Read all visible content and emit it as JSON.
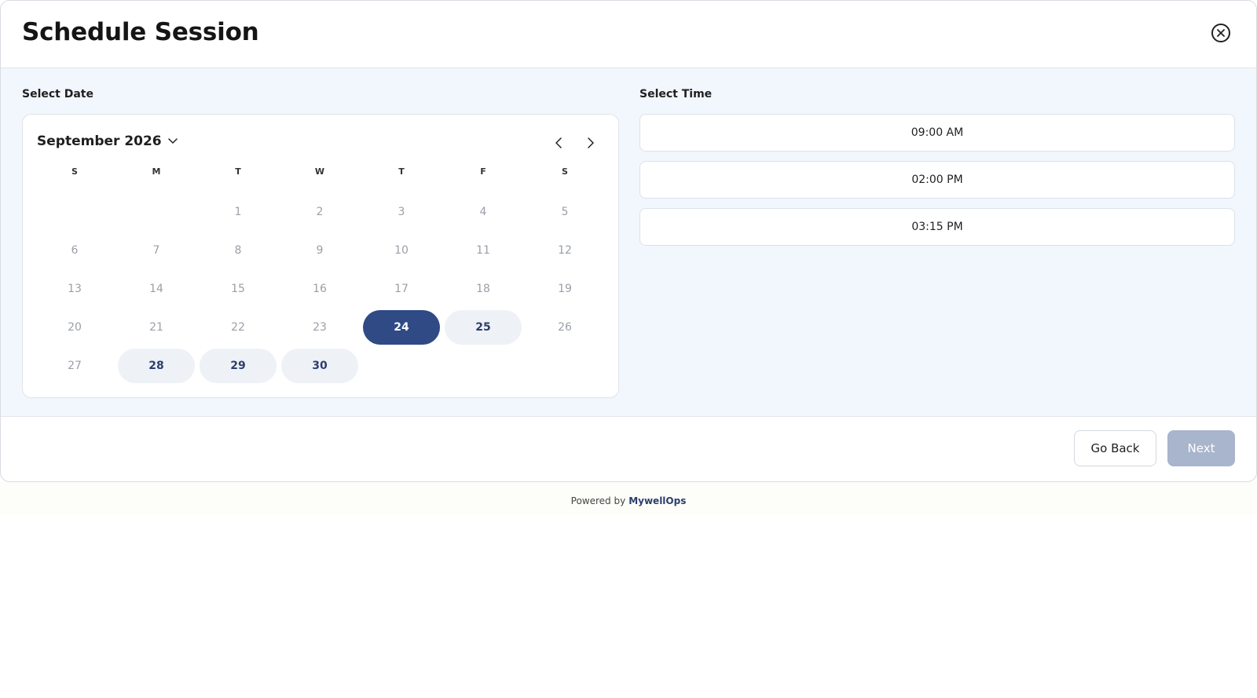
{
  "modal": {
    "title": "Schedule Session"
  },
  "date_section": {
    "label": "Select Date",
    "month_label": "September 2026",
    "weekdays": [
      "S",
      "M",
      "T",
      "W",
      "T",
      "F",
      "S"
    ],
    "days": [
      {
        "label": "",
        "state": "empty"
      },
      {
        "label": "",
        "state": "empty"
      },
      {
        "label": "1",
        "state": "disabled"
      },
      {
        "label": "2",
        "state": "disabled"
      },
      {
        "label": "3",
        "state": "disabled"
      },
      {
        "label": "4",
        "state": "disabled"
      },
      {
        "label": "5",
        "state": "disabled"
      },
      {
        "label": "6",
        "state": "disabled"
      },
      {
        "label": "7",
        "state": "disabled"
      },
      {
        "label": "8",
        "state": "disabled"
      },
      {
        "label": "9",
        "state": "disabled"
      },
      {
        "label": "10",
        "state": "disabled"
      },
      {
        "label": "11",
        "state": "disabled"
      },
      {
        "label": "12",
        "state": "disabled"
      },
      {
        "label": "13",
        "state": "disabled"
      },
      {
        "label": "14",
        "state": "disabled"
      },
      {
        "label": "15",
        "state": "disabled"
      },
      {
        "label": "16",
        "state": "disabled"
      },
      {
        "label": "17",
        "state": "disabled"
      },
      {
        "label": "18",
        "state": "disabled"
      },
      {
        "label": "19",
        "state": "disabled"
      },
      {
        "label": "20",
        "state": "disabled"
      },
      {
        "label": "21",
        "state": "disabled"
      },
      {
        "label": "22",
        "state": "disabled"
      },
      {
        "label": "23",
        "state": "disabled"
      },
      {
        "label": "24",
        "state": "selected"
      },
      {
        "label": "25",
        "state": "available"
      },
      {
        "label": "26",
        "state": "disabled"
      },
      {
        "label": "27",
        "state": "disabled"
      },
      {
        "label": "28",
        "state": "available"
      },
      {
        "label": "29",
        "state": "available"
      },
      {
        "label": "30",
        "state": "available"
      }
    ]
  },
  "time_section": {
    "label": "Select Time",
    "slots": [
      "09:00 AM",
      "02:00 PM",
      "03:15 PM"
    ]
  },
  "actions": {
    "back_label": "Go Back",
    "next_label": "Next"
  },
  "footer": {
    "powered_by": "Powered by",
    "brand": "MywellOps"
  },
  "colors": {
    "selected": "#2f4a85",
    "available_bg": "#eef1f6",
    "body_bg": "#f2f6fd",
    "next_disabled": "#a9b5cc"
  },
  "icons": {
    "close": "close-circle-icon",
    "month_dropdown": "chevron-down-icon",
    "prev": "chevron-left-icon",
    "next": "chevron-right-icon"
  }
}
